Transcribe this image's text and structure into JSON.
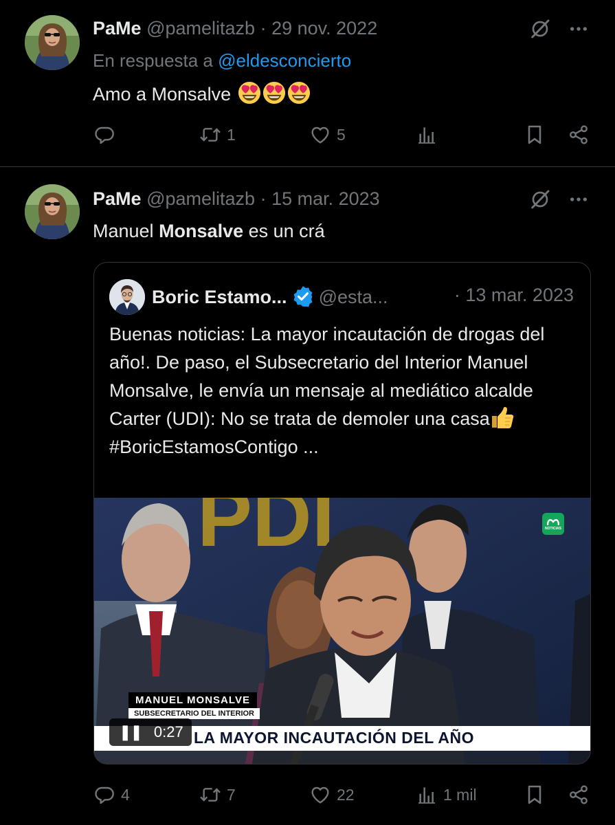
{
  "tweets": [
    {
      "name": "PaMe",
      "handle": "@pamelitazb",
      "separator": "·",
      "date": "29 nov. 2022",
      "reply_prefix": "En respuesta a",
      "reply_to": "@eldesconcierto",
      "text": "Amo a Monsalve",
      "emojis": [
        "heart-eyes",
        "heart-eyes",
        "heart-eyes"
      ],
      "stats": {
        "replies": "",
        "retweets": "1",
        "likes": "5",
        "views": ""
      }
    },
    {
      "name": "PaMe",
      "handle": "@pamelitazb",
      "separator": "·",
      "date": "15 mar. 2023",
      "text_plain_1": "Manuel ",
      "text_bold": "Monsalve",
      "text_plain_2": " es un crá",
      "stats": {
        "replies": "4",
        "retweets": "7",
        "likes": "22",
        "views": "1 mil"
      }
    }
  ],
  "quote": {
    "name": "Boric Estamo...",
    "handle": "@esta...",
    "date": "· 13 mar. 2023",
    "text_main": "Buenas noticias: La mayor incautación de drogas del año!. De paso, el Subsecretario del Interior Manuel Monsalve, le envía un mensaje al mediático alcalde Carter (UDI): No se trata de demoler una casa",
    "text_tail": "#BoricEstamosContigo ...",
    "video": {
      "lower_name": "MANUEL MONSALVE",
      "lower_title": "SUBSECRETARIO DEL INTERIOR",
      "headline": "LA MAYOR INCAUTACIÓN DEL AÑO",
      "time": "0:27",
      "logo_text": "NOTICIAS",
      "background_sign": "PDI"
    }
  },
  "colors": {
    "background": "#000000",
    "text": "#e7e9ea",
    "muted": "#71767b",
    "link": "#1d9bf0",
    "verified": "#1d9bf0",
    "divider": "#2f3336"
  },
  "icons": [
    "grok-icon",
    "more-icon",
    "reply-icon",
    "retweet-icon",
    "like-icon",
    "views-icon",
    "bookmark-icon",
    "share-icon",
    "verified-badge-icon",
    "pause-icon",
    "thumbs-up-emoji",
    "heart-eyes-emoji"
  ]
}
